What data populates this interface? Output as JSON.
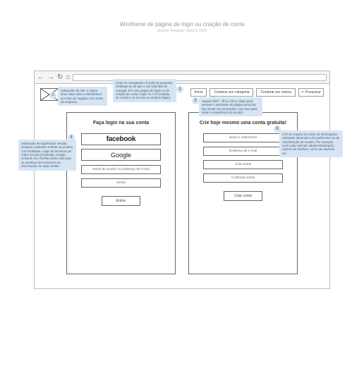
{
  "page": {
    "title": "Wireframe de página de login ou criação de conta",
    "subtitle": "System Template | April 3, 2020"
  },
  "nav": {
    "home": "Início",
    "by_category": "Comprar por categoria",
    "by_brand": "Comprar por marca",
    "search": "Pesquisar"
  },
  "login_panel": {
    "heading": "Faça login na sua conta",
    "facebook": "facebook",
    "google": "Google",
    "username_field": "Nome de usuário ou endereço de e-mail",
    "password_field": "Senha",
    "submit": "Entrar"
  },
  "signup_panel": {
    "heading": "Crie hoje mesmo uma conta gratuita!",
    "name_field": "Nome e sobrenome",
    "email_field": "Endereço de e-mail",
    "password_field": "Criar senha",
    "confirm_field": "Confirmar senha",
    "submit": "Criar conta"
  },
  "callouts": {
    "c1": "Cabeçalho do site: a marca deve estar clara e identificável, por meio do logotipo e/ou nome da empresa.",
    "c2": "Links de navegação e função de pesquisa: certifique-se de que o site seja fácil de navegar. Em uma página de login ou de criação de conta, foque no CTA (criação de conta) e no acesso ao produto (login).",
    "c3": "Segure Shift + ⌘ ou Ctrl e clique para acessar o wireframe da página inicial da loja virtual com anotações. Use isso para testar a experiência do usuário.",
    "c4": "Solicitação de login/iniciar sessão: usuários existentes entram no produto com facilidade. Login de terceiros por redes sociais (Facebook, Google, LinkedIn etc.) facilita ainda mais para os usuários sincronizarem as informações de suas contas.",
    "c5": "CTA de criação de conta: as informações coletadas dependem dos perfis-alvo ou da classificação de usuário. Por exemplo, você pode solicitar cidade/estado/país, número de telefone, nome da empresa etc."
  },
  "nums": {
    "n1": "1",
    "n2": "2",
    "n3": "3",
    "n4": "4",
    "n5": "5"
  }
}
